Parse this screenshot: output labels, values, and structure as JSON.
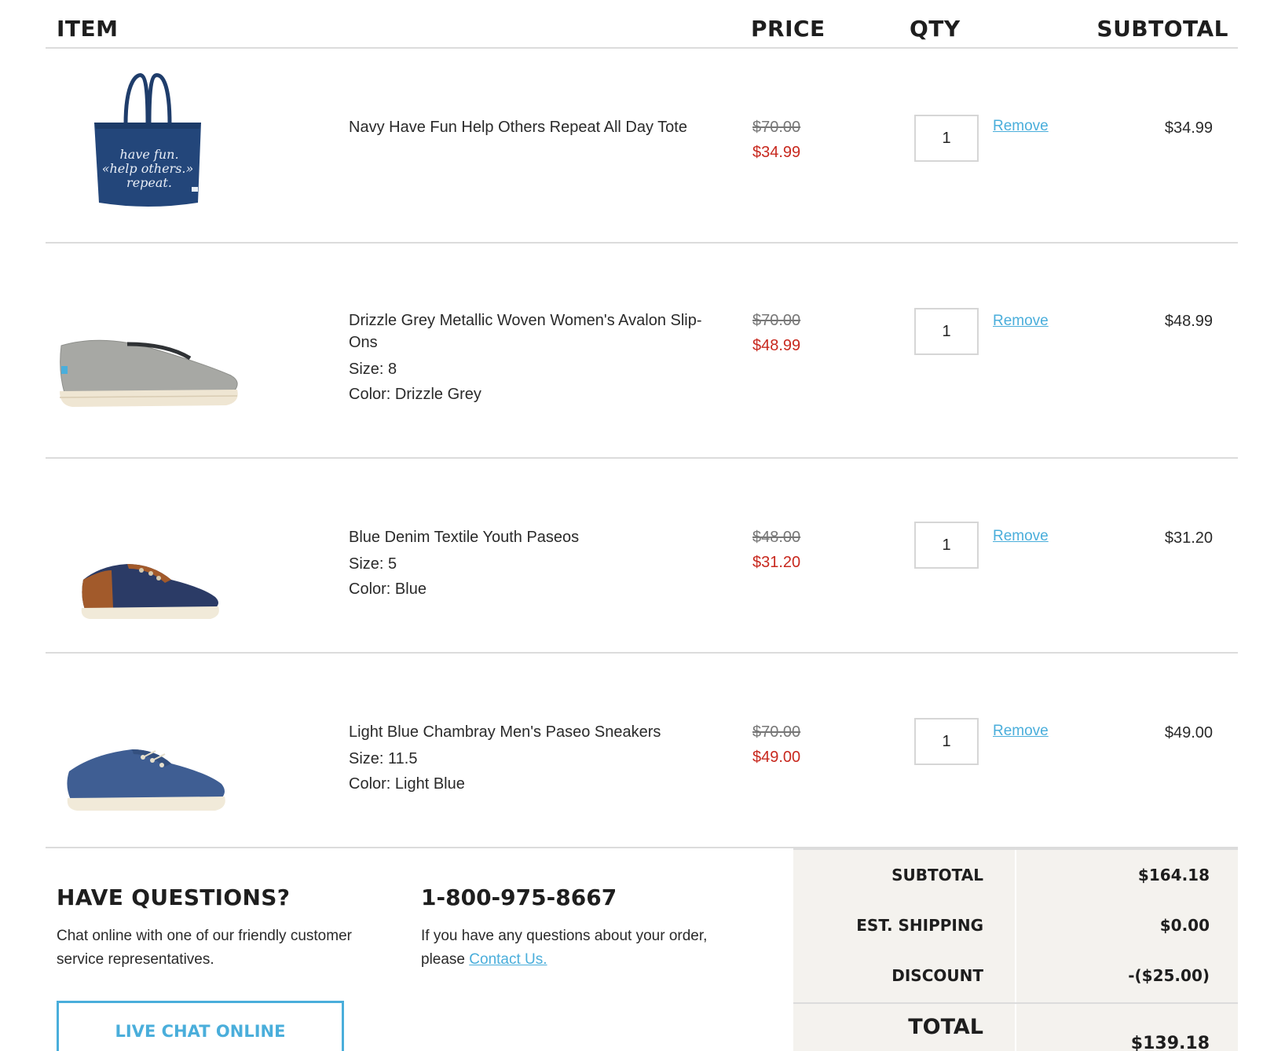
{
  "header": {
    "item": "ITEM",
    "price": "PRICE",
    "qty": "QTY",
    "subtotal": "SUBTOTAL"
  },
  "items": [
    {
      "name": "Navy Have Fun Help Others Repeat All Day Tote",
      "size": "",
      "color": "",
      "original_price": "$70.00",
      "sale_price": "$34.99",
      "qty": "1",
      "remove_label": "Remove",
      "subtotal": "$34.99",
      "image_icon": "navy-tote-bag",
      "image_text": [
        "have fun.",
        "«help others.»",
        "repeat."
      ]
    },
    {
      "name": "Drizzle Grey Metallic Woven Women's Avalon Slip-Ons",
      "size": "Size: 8",
      "color": "Color: Drizzle Grey",
      "original_price": "$70.00",
      "sale_price": "$48.99",
      "qty": "1",
      "remove_label": "Remove",
      "subtotal": "$48.99",
      "image_icon": "grey-slip-on-shoe"
    },
    {
      "name": "Blue Denim Textile Youth Paseos",
      "size": "Size: 5",
      "color": "Color: Blue",
      "original_price": "$48.00",
      "sale_price": "$31.20",
      "qty": "1",
      "remove_label": "Remove",
      "subtotal": "$31.20",
      "image_icon": "blue-denim-sneaker"
    },
    {
      "name": "Light Blue Chambray Men's Paseo Sneakers",
      "size": "Size: 11.5",
      "color": "Color: Light Blue",
      "original_price": "$70.00",
      "sale_price": "$49.00",
      "qty": "1",
      "remove_label": "Remove",
      "subtotal": "$49.00",
      "image_icon": "chambray-sneaker"
    }
  ],
  "help": {
    "title": "HAVE QUESTIONS?",
    "text": "Chat online with one of our friendly customer service representatives.",
    "button": "LIVE CHAT ONLINE"
  },
  "phone": {
    "number": "1-800-975-8667",
    "text": "If you have any questions about your order, please",
    "link": "Contact Us."
  },
  "summary": {
    "subtotal_label": "SUBTOTAL",
    "subtotal_value": "$164.18",
    "shipping_label": "EST. SHIPPING",
    "shipping_value": "$0.00",
    "discount_label": "DISCOUNT",
    "discount_value": "-($25.00)",
    "total_label": "TOTAL",
    "total_value": "$139.18"
  },
  "colors": {
    "sale_red": "#c8281e",
    "link_blue": "#4aaedb",
    "summary_bg": "#f4f2ee",
    "divider": "#dcdcdc"
  }
}
